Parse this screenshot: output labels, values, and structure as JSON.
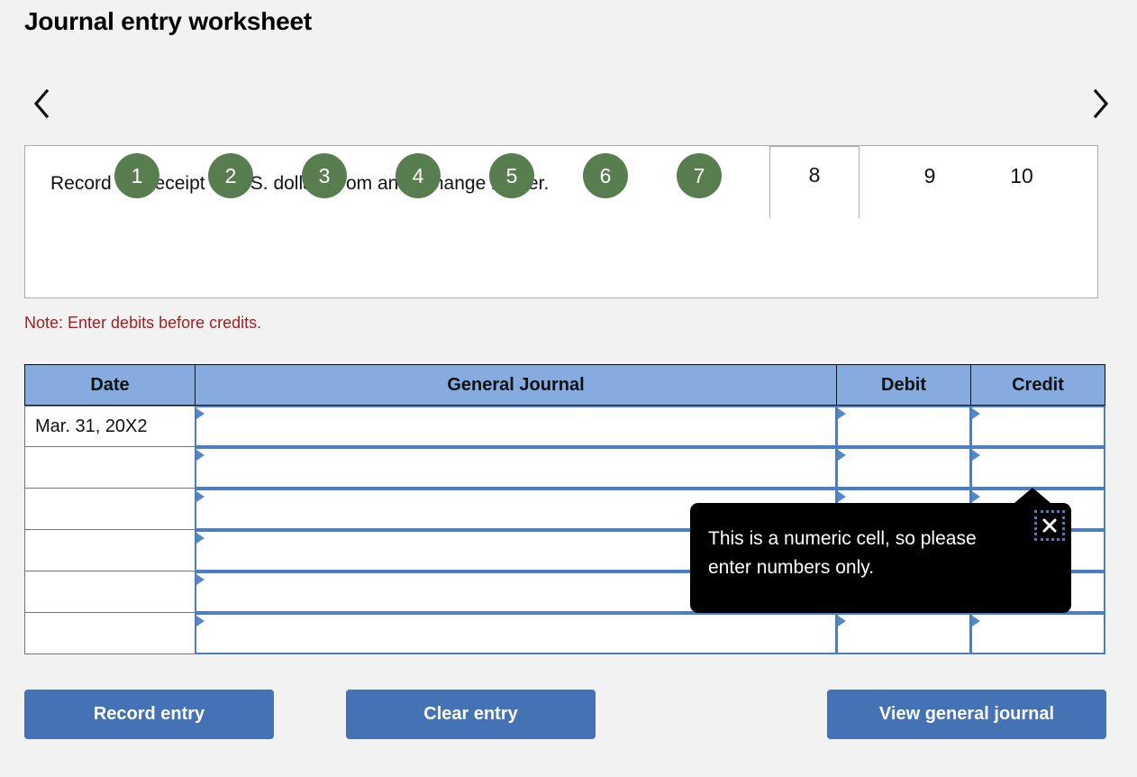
{
  "page": {
    "title": "Journal entry worksheet"
  },
  "tabs": {
    "prev_icon": "chevron-left-icon",
    "next_icon": "chevron-right-icon",
    "active_index": 8,
    "items": [
      {
        "label": "1",
        "state": "completed"
      },
      {
        "label": "2",
        "state": "completed"
      },
      {
        "label": "3",
        "state": "completed"
      },
      {
        "label": "4",
        "state": "completed"
      },
      {
        "label": "5",
        "state": "completed"
      },
      {
        "label": "6",
        "state": "completed"
      },
      {
        "label": "7",
        "state": "completed"
      },
      {
        "label": "8",
        "state": "active"
      },
      {
        "label": "9",
        "state": "pending"
      },
      {
        "label": "10",
        "state": "pending"
      }
    ]
  },
  "instruction": {
    "text": "Record the receipt of U.S. dollars from an exchange broker."
  },
  "note": {
    "text": "Note: Enter debits before credits."
  },
  "journal": {
    "columns": [
      "Date",
      "General Journal",
      "Debit",
      "Credit"
    ],
    "rows": [
      {
        "date": "Mar. 31, 20X2",
        "general_journal": "",
        "debit": "",
        "credit": ""
      },
      {
        "date": "",
        "general_journal": "",
        "debit": "",
        "credit": ""
      },
      {
        "date": "",
        "general_journal": "",
        "debit": "",
        "credit": ""
      },
      {
        "date": "",
        "general_journal": "",
        "debit": "",
        "credit": ""
      },
      {
        "date": "",
        "general_journal": "",
        "debit": "",
        "credit": ""
      },
      {
        "date": "",
        "general_journal": "",
        "debit": "",
        "credit": ""
      }
    ]
  },
  "tooltip": {
    "message": "This is a numeric cell, so please enter numbers only.",
    "close_icon": "close-x-icon"
  },
  "footer": {
    "record_label": "Record entry",
    "clear_label": "Clear entry",
    "view_label": "View general journal"
  },
  "colors": {
    "page_bg": "#f2f2f2",
    "tab_completed": "#587D4F",
    "table_header": "#85ABDF",
    "cell_border": "#4A7FC1",
    "button": "#4472B4",
    "note": "#A02020",
    "tooltip_bg": "#000000"
  }
}
